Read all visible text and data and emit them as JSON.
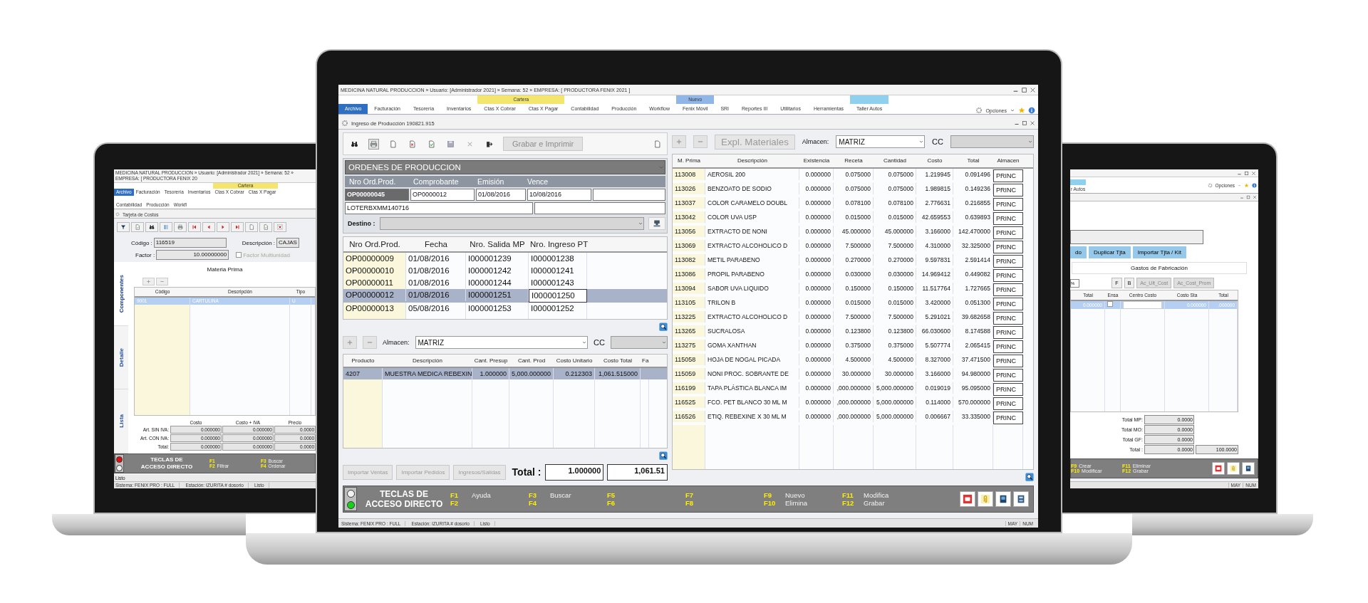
{
  "center": {
    "title": "MEDICINA NATURAL PRODUCCION » Usuario: [Administrador 2021] » Semana: 52 » EMPRESA: [ PRODUCTORA FENIX 2021 ]",
    "tab_groups": [
      {
        "tabs": [
          {
            "label": "Archivo",
            "selected": true
          },
          {
            "label": "Facturación",
            "selected": false
          },
          {
            "label": "Tesorería",
            "selected": false
          },
          {
            "label": "Inventarios",
            "selected": false
          }
        ]
      },
      {
        "label": "Cartera",
        "color": "#f3e56e",
        "tabs": [
          {
            "label": "Ctas X Cobrar",
            "selected": false
          },
          {
            "label": "Ctas X Pagar",
            "selected": false
          }
        ]
      },
      {
        "tabs": [
          {
            "label": "Contabilidad",
            "selected": false
          },
          {
            "label": "Producción",
            "selected": false
          },
          {
            "label": "Workflow",
            "selected": false
          }
        ]
      },
      {
        "label": "Nuevo",
        "color": "#8fb6e6",
        "tabs": [
          {
            "label": "Fenix Móvil",
            "selected": false
          }
        ]
      },
      {
        "tabs": [
          {
            "label": "SRI",
            "selected": false
          },
          {
            "label": "Reportes III",
            "selected": false
          },
          {
            "label": "Utilitarios",
            "selected": false
          },
          {
            "label": "Herramientas",
            "selected": false
          }
        ]
      },
      {
        "color": "#8fd0ef",
        "tabs": [
          {
            "label": "Taller Autos",
            "selected": false
          }
        ]
      }
    ],
    "options": "Opciones",
    "document_title": "Ingreso de Producción 190821.915",
    "grabar_button": {
      "label": "Grabar e Imprimir",
      "disabled": true
    },
    "orders_form": {
      "title": "ORDENES DE PRODUCCION",
      "columns": [
        "Nro Ord.Prod.",
        "Comprobante",
        "Emisión",
        "Vence"
      ],
      "values": [
        "OP00000045",
        "OP0000012",
        "01/08/2016",
        "10/08/2016"
      ],
      "lote": "LOTERBXMM140716",
      "destino_label": "Destino :"
    },
    "orders_grid": {
      "columns": [
        "Nro Ord.Prod.",
        "Fecha",
        "Nro. Salida MP",
        "Nro. Ingreso PT"
      ],
      "rows": [
        {
          "cells": [
            "OP00000009",
            "01/08/2016",
            "I000001239",
            "I000001238"
          ],
          "selected": false
        },
        {
          "cells": [
            "OP00000010",
            "01/08/2016",
            "I000001242",
            "I000001241"
          ],
          "selected": false
        },
        {
          "cells": [
            "OP00000011",
            "01/08/2016",
            "I000001244",
            "I000001243"
          ],
          "selected": false
        },
        {
          "cells": [
            "OP00000012",
            "01/08/2016",
            "I000001251",
            "I000001250"
          ],
          "selected": true
        },
        {
          "cells": [
            "OP00000013",
            "05/08/2016",
            "I000001253",
            "I000001252"
          ],
          "selected": false
        }
      ]
    },
    "products_bar": {
      "almacen_label": "Almacen:",
      "almacen_value": "MATRIZ",
      "cc_label": "CC"
    },
    "products_grid": {
      "columns": [
        "Producto",
        "Descripción",
        "Cant. Presup",
        "Cant. Prod",
        "Costo Unitario",
        "Costo Total",
        "Fa"
      ],
      "rows": [
        {
          "cells": [
            "4207",
            "MUESTRA MEDICA REBEXIN",
            "1.000000",
            "5,000.000000",
            "0.212303",
            "1,061.515000"
          ],
          "selected": true
        }
      ]
    },
    "footer_buttons": [
      {
        "label": "Importar Ventas",
        "disabled": true
      },
      {
        "label": "Importar Pedidos",
        "disabled": true
      },
      {
        "label": "Ingresos/Salidas",
        "disabled": true
      }
    ],
    "total": {
      "label": "Total :",
      "quantity": "1.000000",
      "cost": "1,061.51"
    },
    "materials_bar": {
      "expl_button": {
        "label": "Expl. Materiales",
        "disabled": true
      },
      "almacen_label": "Almacen:",
      "almacen_value": "MATRIZ",
      "cc_label": "CC"
    },
    "materials_grid": {
      "columns": [
        "M. Prima",
        "Descripción",
        "Existencia",
        "Receta",
        "Cantidad",
        "Costo",
        "Total",
        "Almacen"
      ],
      "rows": [
        [
          "113008",
          "AEROSIL 200",
          "0.000000",
          "0.075000",
          "0.075000",
          "1.219945",
          "0.091496",
          "PRINC"
        ],
        [
          "113026",
          "BENZOATO DE SODIO",
          "0.000000",
          "0.075000",
          "0.075000",
          "1.989815",
          "0.149236",
          "PRINC"
        ],
        [
          "113037",
          "COLOR CARAMELO DOUBL",
          "0.000000",
          "0.078100",
          "0.078100",
          "2.776631",
          "0.216855",
          "PRINC"
        ],
        [
          "113042",
          "COLOR UVA USP",
          "0.000000",
          "0.015000",
          "0.015000",
          "42.659553",
          "0.639893",
          "PRINC"
        ],
        [
          "113056",
          "EXTRACTO DE NONI",
          "0.000000",
          "45.000000",
          "45.000000",
          "3.166000",
          "142.470000",
          "PRINC"
        ],
        [
          "113069",
          "EXTRACTO ALCOHOLICO D",
          "0.000000",
          "7.500000",
          "7.500000",
          "4.310000",
          "32.325000",
          "PRINC"
        ],
        [
          "113082",
          "METIL PARABENO",
          "0.000000",
          "0.270000",
          "0.270000",
          "9.597831",
          "2.591414",
          "PRINC"
        ],
        [
          "113086",
          "PROPIL PARABENO",
          "0.000000",
          "0.030000",
          "0.030000",
          "14.969412",
          "0.449082",
          "PRINC"
        ],
        [
          "113094",
          "SABOR UVA LIQUIDO",
          "0.000000",
          "0.150000",
          "0.150000",
          "11.517764",
          "1.727665",
          "PRINC"
        ],
        [
          "113105",
          "TRILON B",
          "0.000000",
          "0.015000",
          "0.015000",
          "3.420000",
          "0.051300",
          "PRINC"
        ],
        [
          "113225",
          "EXTRACTO ALCOHOLICO D",
          "0.000000",
          "7.500000",
          "7.500000",
          "5.291021",
          "39.682658",
          "PRINC"
        ],
        [
          "113265",
          "SUCRALOSA",
          "0.000000",
          "0.123800",
          "0.123800",
          "66.030600",
          "8.174588",
          "PRINC"
        ],
        [
          "113275",
          "GOMA XANTHAN",
          "0.000000",
          "0.375000",
          "0.375000",
          "5.507774",
          "2.065415",
          "PRINC"
        ],
        [
          "115058",
          "HOJA DE NOGAL PICADA",
          "0.000000",
          "4.500000",
          "4.500000",
          "8.327000",
          "37.471500",
          "PRINC"
        ],
        [
          "115059",
          "NONI PROC. SOBRANTE DE",
          "0.000000",
          "30.000000",
          "30.000000",
          "3.166000",
          "94.980000",
          "PRINC"
        ],
        [
          "116199",
          "TAPA PLÁSTICA BLANCA IM",
          "0.000000",
          ",000.000000",
          "5,000.000000",
          "0.019019",
          "95.095000",
          "PRINC"
        ],
        [
          "116525",
          "FCO. PET BLANCO 30 ML M",
          "0.000000",
          ",000.000000",
          "5,000.000000",
          "0.114000",
          "570.000000",
          "PRINC"
        ],
        [
          "116526",
          "ETIQ. REBEXINE X 30 ML M",
          "0.000000",
          ",000.000000",
          "5,000.000000",
          "0.006667",
          "33.335000",
          "PRINC"
        ]
      ]
    },
    "shortcuts": {
      "title": [
        "TECLAS DE",
        "ACCESO DIRECTO"
      ],
      "lights": [
        {
          "color": "#f2f2f2"
        },
        {
          "color": "#18d018"
        }
      ],
      "keys": [
        {
          "key": "F1",
          "label": "Ayuda"
        },
        {
          "key": "F2"
        },
        {
          "key": "F3",
          "label": "Buscar"
        },
        {
          "key": "F4"
        },
        {
          "key": "F5"
        },
        {
          "key": "F6"
        },
        {
          "key": "F7"
        },
        {
          "key": "F8"
        },
        {
          "key": "F9",
          "label": "Nuevo"
        },
        {
          "key": "F10",
          "label": "Elimina"
        },
        {
          "key": "F11",
          "label": "Modifica"
        },
        {
          "key": "F12",
          "label": "Grabar"
        }
      ]
    },
    "status_bar": {
      "items": [
        "Sistema: FENIX PRO : FULL",
        "Estación: IZURITA # dosorio",
        "Listo"
      ],
      "indicators": [
        "MAY",
        "NUM"
      ]
    }
  },
  "left": {
    "title": "MEDICINA NATURAL PRODUCCION » Usuario: [Administrador 2021] » Semana: 52 » EMPRESA: [ PRODUCTORA FENIX 20",
    "tab_groups": [
      {
        "tabs": [
          {
            "label": "Archivo",
            "selected": true
          },
          {
            "label": "Facturación",
            "selected": false
          },
          {
            "label": "Tesorería",
            "selected": false
          },
          {
            "label": "Inventarios",
            "selected": false
          }
        ]
      },
      {
        "label": "Cartera",
        "color": "#f3e56e",
        "tabs": [
          {
            "label": "Ctas X Cobrar",
            "selected": false
          },
          {
            "label": "Ctas X Pagar",
            "selected": false
          }
        ]
      },
      {
        "tabs": [
          {
            "label": "Contabilidad",
            "selected": false
          },
          {
            "label": "Producción",
            "selected": false
          },
          {
            "label": "Workfl",
            "selected": false
          }
        ]
      }
    ],
    "document_title": "Tarjeta de Costos",
    "form": {
      "codigo_label": "Código :",
      "codigo": "116519",
      "descripcion_label": "Descripción :",
      "descripcion": "CAJAS",
      "factor_label": "Factor :",
      "factor": "10.00000000",
      "multiunidad": {
        "label": "Factor Multiunidad",
        "checked": false,
        "disabled": true
      }
    },
    "side_tabs": [
      {
        "label": "Componentes",
        "selected": true
      },
      {
        "label": "Detalle",
        "selected": false
      },
      {
        "label": "Lista",
        "selected": false
      }
    ],
    "section_title": "Materia Prima",
    "grid": {
      "columns": [
        "Código",
        "Descripción",
        "Tipo"
      ],
      "rows": [
        {
          "cells": [
            "9001",
            "CARTULINA",
            "U"
          ],
          "selected": true
        }
      ]
    },
    "prices": {
      "columns": [
        "Costo",
        "Costo + IVA",
        "Precio"
      ],
      "rows": [
        {
          "label": "Art. SIN IVA:",
          "values": [
            "0.000000",
            "0.000000",
            "0.0000"
          ]
        },
        {
          "label": "Art. CON IVA:",
          "values": [
            "0.000000",
            "0.000000",
            "0.0000"
          ]
        },
        {
          "label": "Total:",
          "values": [
            "0.000000",
            "0.000000",
            "0.0000"
          ]
        }
      ]
    },
    "shortcuts": {
      "title": [
        "TECLAS DE",
        "ACCESO DIRECTO"
      ],
      "lights": [
        {
          "color": "#e01010"
        },
        {
          "color": "#f2f2f2"
        }
      ],
      "keys": [
        {
          "key": "F1"
        },
        {
          "key": "F2",
          "label": "Filtrar"
        },
        {
          "key": "F3",
          "label": "Buscar"
        },
        {
          "key": "F4",
          "label": "Ordenar"
        }
      ]
    },
    "message": "Listo",
    "status_bar": {
      "items": [
        "Sistema: FENIX PRO : FULL",
        "Estación: IZURITA # dosorio",
        "Listo"
      ]
    }
  },
  "right": {
    "tab_fragment": {
      "label": "r Autos",
      "color": "#8fd0ef"
    },
    "options": "Opciones",
    "buttons": [
      {
        "label": "do"
      },
      {
        "label": "Duplicar Tjta"
      },
      {
        "label": "Importar Tjta / Kit"
      }
    ],
    "section_title": "Gastos de Fabricación",
    "percent": "%",
    "tool_buttons": [
      {
        "label": "F",
        "disabled": false
      },
      {
        "label": "B",
        "disabled": false
      },
      {
        "label": "Ac_Ult_Cost",
        "disabled": true
      },
      {
        "label": "Ac_Cost_Prom",
        "disabled": true
      }
    ],
    "grid": {
      "columns": [
        "Total",
        "Ensa",
        "Centro Costo",
        "Costo Sta",
        "Total"
      ],
      "rows": [
        {
          "total": "0.000000",
          "ensa_checked": false,
          "costo_sta": "0.000000",
          "total_2": ".000000",
          "selected": true
        }
      ]
    },
    "totals": [
      {
        "label": "Total MP:",
        "value": "0.0000"
      },
      {
        "label": "Total MO:",
        "value": "0.0000"
      },
      {
        "label": "Total GF:",
        "value": "0.0000"
      },
      {
        "label": "Total :",
        "value": "0.0000",
        "extra": "100.0000"
      }
    ],
    "shortcuts": {
      "keys": [
        {
          "key": "F9",
          "label": "Crear"
        },
        {
          "key": "F10",
          "label": "Modificar"
        },
        {
          "key": "F11",
          "label": "Eliminar"
        },
        {
          "key": "F12",
          "label": "Grabar"
        }
      ]
    },
    "status_bar": {
      "indicators": [
        "MAY",
        "NUM"
      ]
    }
  }
}
